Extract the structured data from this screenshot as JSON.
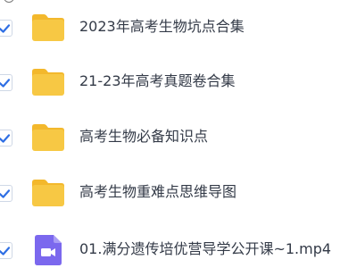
{
  "colors": {
    "check": "#2f6fe4",
    "folder": "#f7c844",
    "folder_tab": "#f3b82c",
    "video": "#7b68ee",
    "text": "#333a47"
  },
  "files": [
    {
      "name": "2023年高考生物坑点合集",
      "type": "folder",
      "icon": "folder-icon",
      "selected": true
    },
    {
      "name": "21-23年高考真题卷合集",
      "type": "folder",
      "icon": "folder-icon",
      "selected": true
    },
    {
      "name": "高考生物必备知识点",
      "type": "folder",
      "icon": "folder-icon",
      "selected": true
    },
    {
      "name": "高考生物重难点思维导图",
      "type": "folder",
      "icon": "folder-icon",
      "selected": true
    },
    {
      "name": "01.满分遗传培优营导学公开课~1.mp4",
      "type": "video",
      "icon": "video-file-icon",
      "selected": true
    }
  ]
}
